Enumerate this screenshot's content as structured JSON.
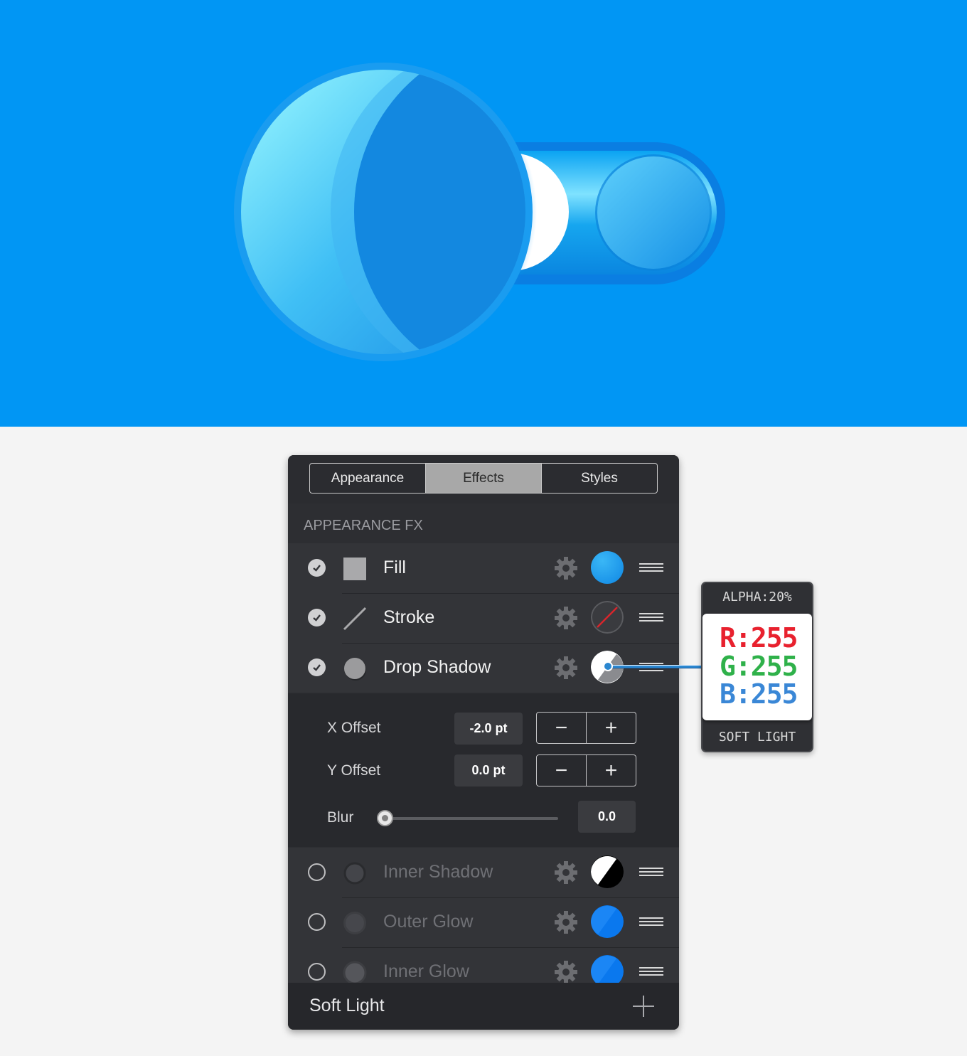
{
  "panel": {
    "tabs": [
      {
        "label": "Appearance",
        "active": false
      },
      {
        "label": "Effects",
        "active": true
      },
      {
        "label": "Styles",
        "active": false
      }
    ],
    "section_title": "APPEARANCE FX",
    "effects": [
      {
        "label": "Fill",
        "enabled": true,
        "icon": "square-fill-icon",
        "swatch": "#1e9be9"
      },
      {
        "label": "Stroke",
        "enabled": true,
        "icon": "stroke-line-icon",
        "swatch": "#3a3b3f"
      },
      {
        "label": "Drop Shadow",
        "enabled": true,
        "icon": "circle-shadow-icon",
        "swatch": "#ffffff"
      },
      {
        "label": "Inner Shadow",
        "enabled": false,
        "icon": "circle-shadow-icon",
        "swatch": "#000000"
      },
      {
        "label": "Outer Glow",
        "enabled": false,
        "icon": "circle-glow-icon",
        "swatch": "#0a78ee"
      },
      {
        "label": "Inner Glow",
        "enabled": false,
        "icon": "circle-glow-icon",
        "swatch": "#0a78ee"
      }
    ],
    "drop_shadow": {
      "x_offset_label": "X Offset",
      "x_offset_value": "-2.0 pt",
      "y_offset_label": "Y Offset",
      "y_offset_value": "0.0 pt",
      "blur_label": "Blur",
      "blur_value": "0.0",
      "blur_slider_fraction": 0.0,
      "minus": "−",
      "plus": "+"
    },
    "footer": {
      "blend_mode": "Soft Light"
    }
  },
  "tooltip": {
    "alpha": "ALPHA:20%",
    "r": "R:255",
    "g": "G:255",
    "b": "B:255",
    "blend_mode": "SOFT LIGHT",
    "colors": {
      "r": "#e8212e",
      "g": "#2fb14a",
      "b": "#3a87d6"
    }
  },
  "hero": {
    "background": "#0196f4",
    "accent_dark": "#0a7fe0",
    "accent_light": "#8ff0ff"
  }
}
